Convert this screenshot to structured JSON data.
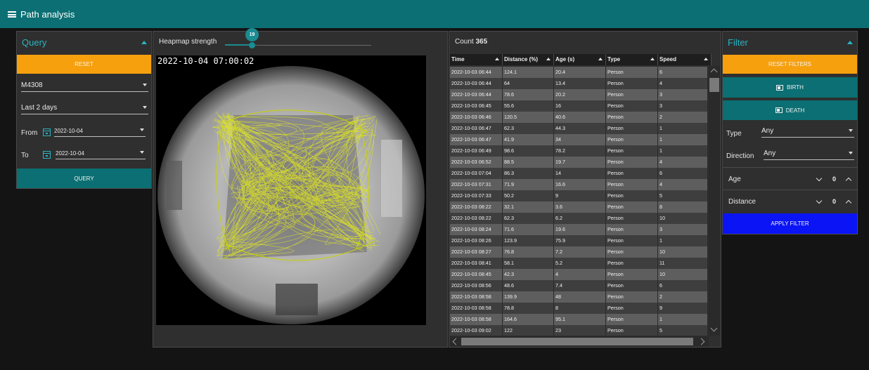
{
  "app": {
    "title": "Path analysis"
  },
  "colors": {
    "accent": "#0b6f73",
    "orange": "#f7a00d",
    "blue": "#0a14f5",
    "title_teal": "#2bb3c0"
  },
  "query": {
    "title": "Query",
    "reset_label": "RESET",
    "camera": "M4308",
    "range": "Last 2 days",
    "from_label": "From",
    "from_date": "2022-10-04",
    "to_label": "To",
    "to_date": "2022-10-04",
    "query_label": "QUERY"
  },
  "heatmap": {
    "strength_label": "Heapmap strength",
    "strength_value": "19",
    "strength_fraction": 0.19,
    "timestamp": "2022-10-04 07:00:02"
  },
  "table": {
    "count_label": "Count",
    "count_value": "365",
    "columns": [
      "Time",
      "Distance (%)",
      "Age (s)",
      "Type",
      "Speed"
    ],
    "rows": [
      [
        "2022-10-03 06:44",
        "124.1",
        "20.4",
        "Person",
        "6"
      ],
      [
        "2022-10-03 06:44",
        "64",
        "13.4",
        "Person",
        "4"
      ],
      [
        "2022-10-03 06:44",
        "78.6",
        "20.2",
        "Person",
        "3"
      ],
      [
        "2022-10-03 06:45",
        "55.6",
        "16",
        "Person",
        "3"
      ],
      [
        "2022-10-03 06:46",
        "120.5",
        "40.6",
        "Person",
        "2"
      ],
      [
        "2022-10-03 06:47",
        "62.3",
        "44.3",
        "Person",
        "1"
      ],
      [
        "2022-10-03 06:47",
        "41.9",
        "34",
        "Person",
        "1"
      ],
      [
        "2022-10-03 06:49",
        "98.6",
        "78.2",
        "Person",
        "1"
      ],
      [
        "2022-10-03 06:52",
        "88.5",
        "19.7",
        "Person",
        "4"
      ],
      [
        "2022-10-03 07:04",
        "86.3",
        "14",
        "Person",
        "6"
      ],
      [
        "2022-10-03 07:31",
        "71.9",
        "16.6",
        "Person",
        "4"
      ],
      [
        "2022-10-03 07:33",
        "50.2",
        "9",
        "Person",
        "5"
      ],
      [
        "2022-10-03 08:22",
        "32.1",
        "3.6",
        "Person",
        "8"
      ],
      [
        "2022-10-03 08:22",
        "62.3",
        "6.2",
        "Person",
        "10"
      ],
      [
        "2022-10-03 08:24",
        "71.6",
        "19.6",
        "Person",
        "3"
      ],
      [
        "2022-10-03 08:26",
        "123.9",
        "75.9",
        "Person",
        "1"
      ],
      [
        "2022-10-03 08:27",
        "76.8",
        "7.2",
        "Person",
        "10"
      ],
      [
        "2022-10-03 08:41",
        "58.1",
        "5.2",
        "Person",
        "11"
      ],
      [
        "2022-10-03 08:45",
        "42.3",
        "4",
        "Person",
        "10"
      ],
      [
        "2022-10-03 08:56",
        "48.6",
        "7.4",
        "Person",
        "6"
      ],
      [
        "2022-10-03 08:58",
        "139.9",
        "48",
        "Person",
        "2"
      ],
      [
        "2022-10-03 08:58",
        "78.8",
        "8",
        "Person",
        "9"
      ],
      [
        "2022-10-03 08:58",
        "164.6",
        "95.1",
        "Person",
        "1"
      ],
      [
        "2022-10-03 09:02",
        "122",
        "23",
        "Person",
        "5"
      ]
    ]
  },
  "filter": {
    "title": "Filter",
    "reset_label": "RESET FILTERS",
    "birth_label": "BIRTH",
    "death_label": "DEATH",
    "type_label": "Type",
    "type_value": "Any",
    "direction_label": "Direction",
    "direction_value": "Any",
    "age_label": "Age",
    "age_value": "0",
    "distance_label": "Distance",
    "distance_value": "0",
    "apply_label": "APPLY FILTER"
  }
}
